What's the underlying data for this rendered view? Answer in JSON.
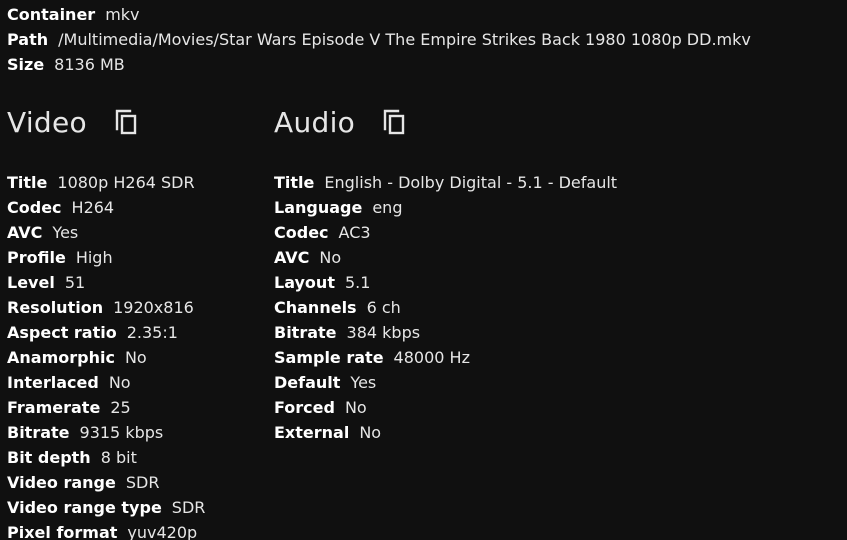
{
  "general": [
    {
      "label": "Container",
      "value": "mkv"
    },
    {
      "label": "Path",
      "value": "/Multimedia/Movies/Star Wars Episode V The Empire Strikes Back 1980 1080p DD.mkv"
    },
    {
      "label": "Size",
      "value": "8136 MB"
    }
  ],
  "video": {
    "title": "Video",
    "copy_icon": "copy-icon",
    "props": [
      {
        "label": "Title",
        "value": "1080p H264 SDR"
      },
      {
        "label": "Codec",
        "value": "H264"
      },
      {
        "label": "AVC",
        "value": "Yes"
      },
      {
        "label": "Profile",
        "value": "High"
      },
      {
        "label": "Level",
        "value": "51"
      },
      {
        "label": "Resolution",
        "value": "1920x816"
      },
      {
        "label": "Aspect ratio",
        "value": "2.35:1"
      },
      {
        "label": "Anamorphic",
        "value": "No"
      },
      {
        "label": "Interlaced",
        "value": "No"
      },
      {
        "label": "Framerate",
        "value": "25"
      },
      {
        "label": "Bitrate",
        "value": "9315 kbps"
      },
      {
        "label": "Bit depth",
        "value": "8 bit"
      },
      {
        "label": "Video range",
        "value": "SDR"
      },
      {
        "label": "Video range type",
        "value": "SDR"
      },
      {
        "label": "Pixel format",
        "value": "yuv420p"
      }
    ]
  },
  "audio": {
    "title": "Audio",
    "copy_icon": "copy-icon",
    "props": [
      {
        "label": "Title",
        "value": "English - Dolby Digital - 5.1 - Default"
      },
      {
        "label": "Language",
        "value": "eng"
      },
      {
        "label": "Codec",
        "value": "AC3"
      },
      {
        "label": "AVC",
        "value": "No"
      },
      {
        "label": "Layout",
        "value": "5.1"
      },
      {
        "label": "Channels",
        "value": "6 ch"
      },
      {
        "label": "Bitrate",
        "value": "384 kbps"
      },
      {
        "label": "Sample rate",
        "value": "48000 Hz"
      },
      {
        "label": "Default",
        "value": "Yes"
      },
      {
        "label": "Forced",
        "value": "No"
      },
      {
        "label": "External",
        "value": "No"
      }
    ]
  },
  "colors": {
    "background": "#101010",
    "text": "#e6e6e6",
    "label": "#ffffff"
  }
}
